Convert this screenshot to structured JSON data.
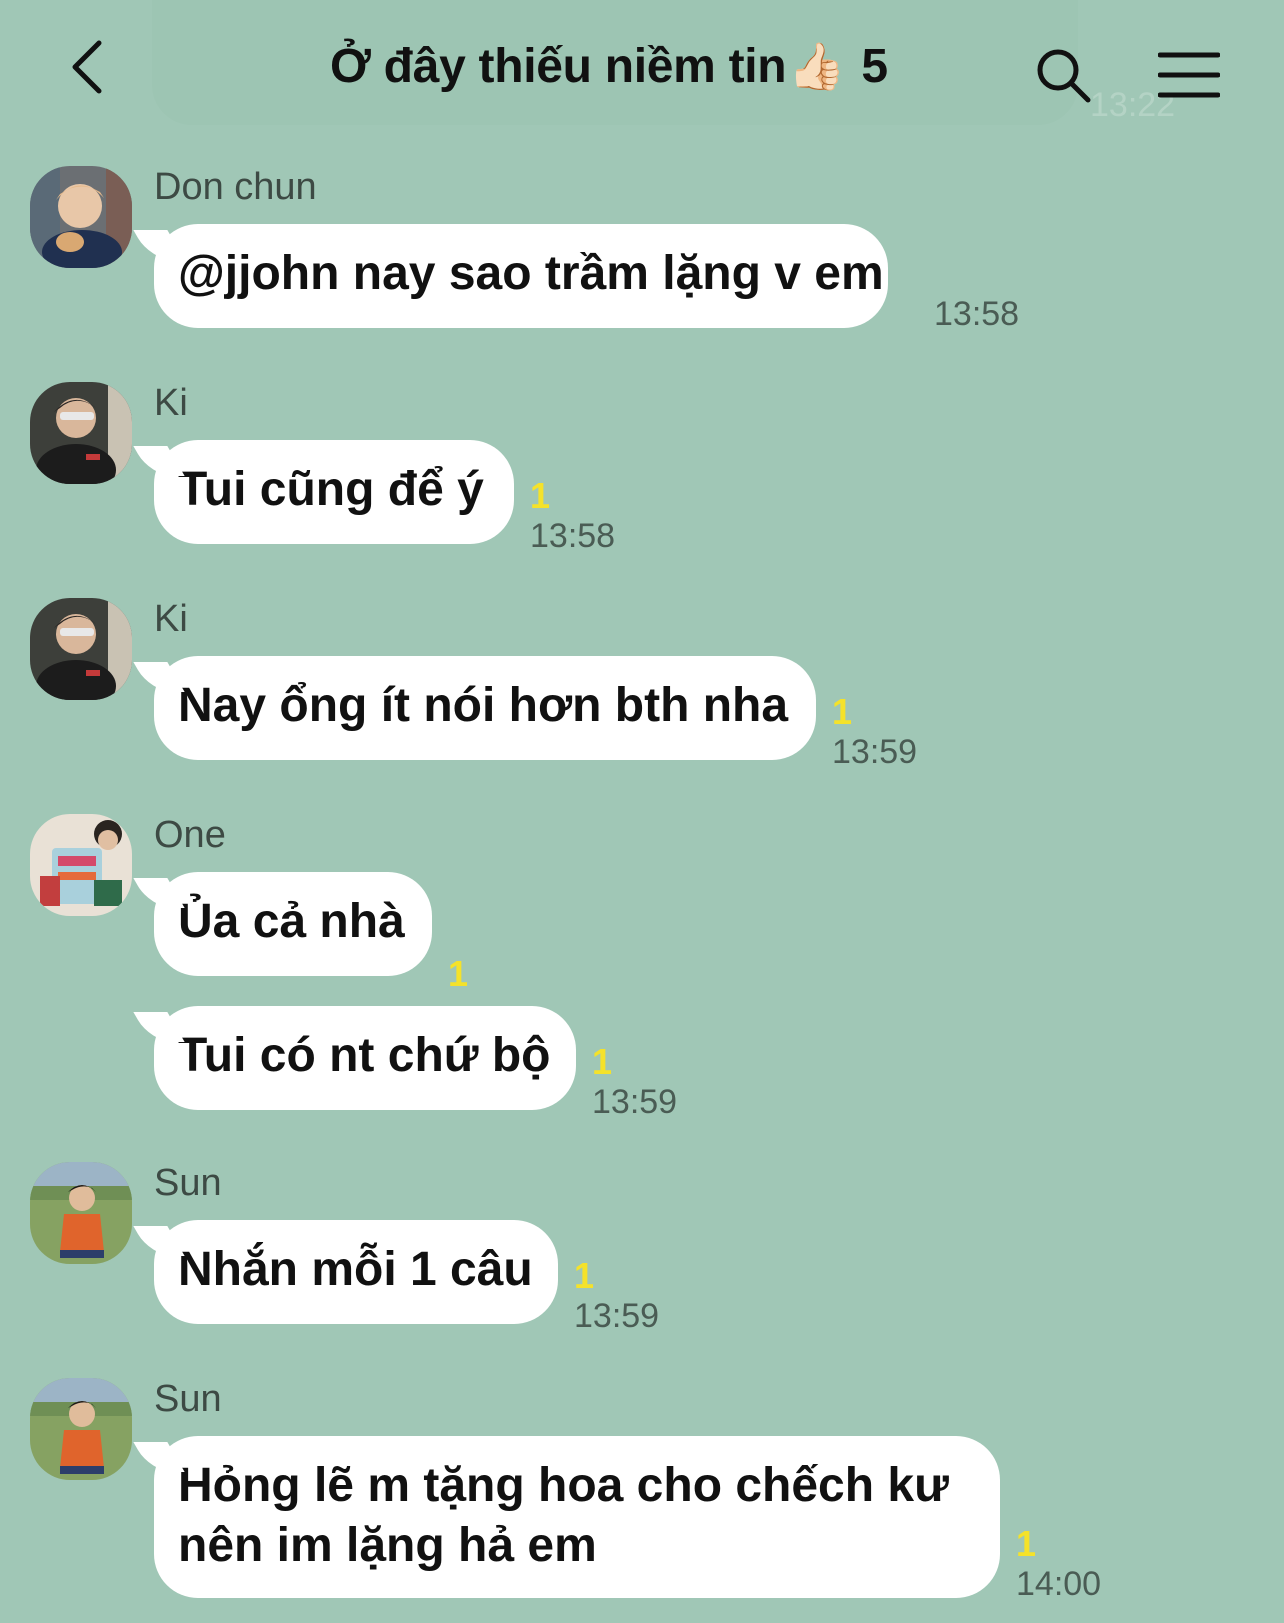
{
  "header": {
    "title": "Ở đây thiếu niềm tin",
    "title_emoji": "👍🏻",
    "member_count": "5",
    "ghost_time": "13:22",
    "back_icon": "chevron-left-icon",
    "search_icon": "search-icon",
    "menu_icon": "menu-icon"
  },
  "messages": [
    {
      "sender": "Don chun",
      "text": "@jjohn nay sao trầm lặng v em",
      "unread": "",
      "time": "13:58"
    },
    {
      "sender": "Ki",
      "text": "Tui cũng để ý",
      "unread": "1",
      "time": "13:58"
    },
    {
      "sender": "Ki",
      "text": "Nay ổng ít nói hơn bth nha",
      "unread": "1",
      "time": "13:59"
    },
    {
      "sender": "One",
      "text": "Ủa cả nhà",
      "unread": "1",
      "time": ""
    },
    {
      "sender": "",
      "text": "Tui có nt chứ bộ",
      "unread": "1",
      "time": "13:59"
    },
    {
      "sender": "Sun",
      "text": "Nhắn mỗi 1 câu",
      "unread": "1",
      "time": "13:59"
    },
    {
      "sender": "Sun",
      "text_line1": "Hỏng lẽ m tặng hoa cho chếch kư",
      "text_line2": "nên im lặng hả em",
      "unread": "1",
      "time": "14:00"
    }
  ],
  "colors": {
    "background": "#a0c7b6",
    "bubble": "#ffffff",
    "unread": "#f5e22a",
    "time": "#4a5c54"
  }
}
